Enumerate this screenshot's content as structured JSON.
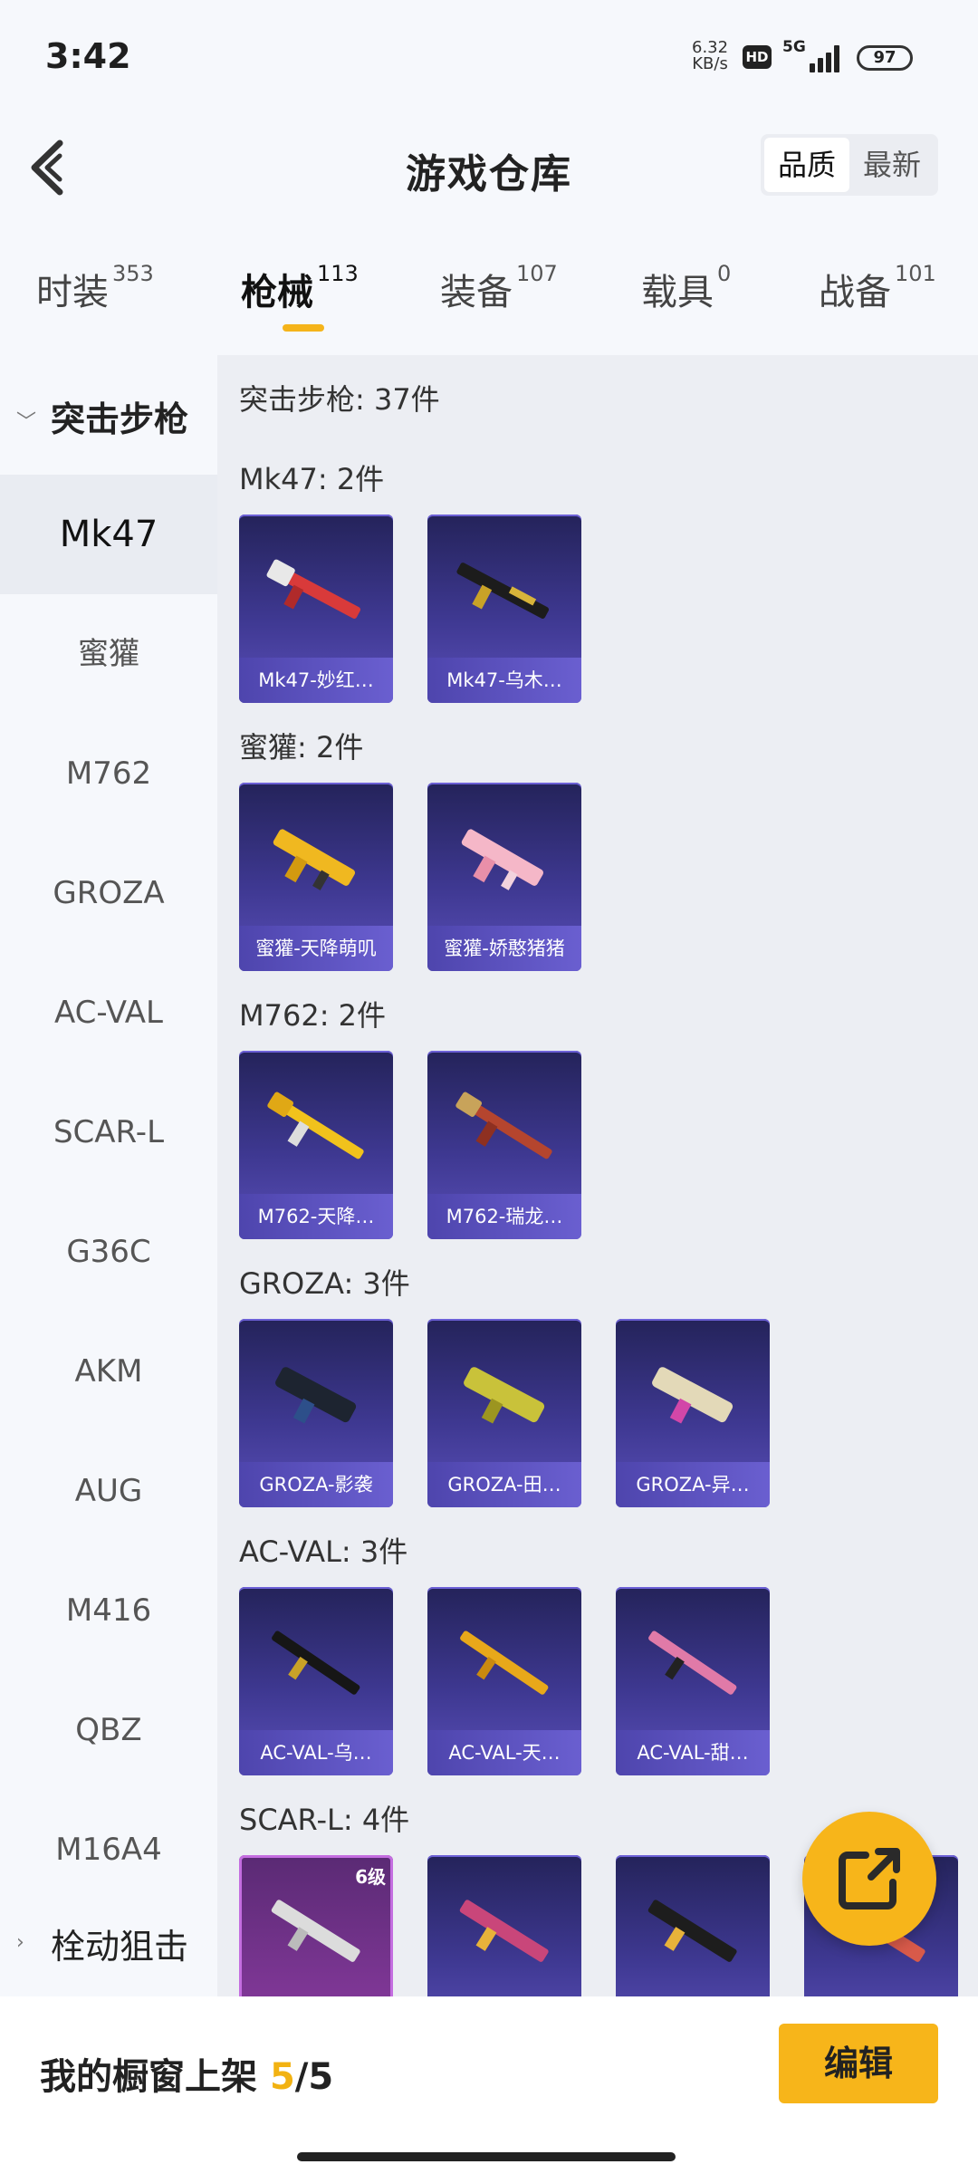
{
  "status_bar": {
    "time": "3:42",
    "net_speed": "6.32",
    "net_unit": "KB/s",
    "hd": "HD",
    "network": "5G",
    "battery": "97"
  },
  "header": {
    "title": "游戏仓库",
    "sort_options": [
      "品质",
      "最新"
    ],
    "sort_selected": "品质"
  },
  "tabs": [
    {
      "label": "时装",
      "count": "353"
    },
    {
      "label": "枪械",
      "count": "113",
      "active": true
    },
    {
      "label": "装备",
      "count": "107"
    },
    {
      "label": "载具",
      "count": "0"
    },
    {
      "label": "战备",
      "count": "101"
    }
  ],
  "sidebar": {
    "category": "突击步枪",
    "items": [
      "Mk47",
      "蜜獾",
      "M762",
      "GROZA",
      "AC-VAL",
      "SCAR-L",
      "G36C",
      "AKM",
      "AUG",
      "M416",
      "QBZ",
      "M16A4"
    ],
    "active": "Mk47",
    "next_category": "栓动狙击"
  },
  "content": {
    "summary": "突击步枪: 37件",
    "sections": [
      {
        "title": "Mk47: 2件",
        "items": [
          "Mk47-妙红…",
          "Mk47-乌木…"
        ]
      },
      {
        "title": "蜜獾: 2件",
        "items": [
          "蜜獾-天降萌叽",
          "蜜獾-娇憨猪猪"
        ]
      },
      {
        "title": "M762: 2件",
        "items": [
          "M762-天降…",
          "M762-瑞龙…"
        ]
      },
      {
        "title": "GROZA: 3件",
        "items": [
          "GROZA-影袭",
          "GROZA-田…",
          "GROZA-异…"
        ]
      },
      {
        "title": "AC-VAL: 3件",
        "items": [
          "AC-VAL-乌…",
          "AC-VAL-天…",
          "AC-VAL-甜…"
        ]
      },
      {
        "title": "SCAR-L: 4件",
        "items": [
          "",
          "",
          "",
          ""
        ],
        "first_level": "6级"
      }
    ]
  },
  "bottom_bar": {
    "label": "我的橱窗上架 ",
    "current": "5",
    "total": "/5",
    "edit_button": "编辑"
  },
  "colors": {
    "accent": "#f7b51a",
    "card_top": "#24235a",
    "card_bottom": "#5a4fb8"
  }
}
